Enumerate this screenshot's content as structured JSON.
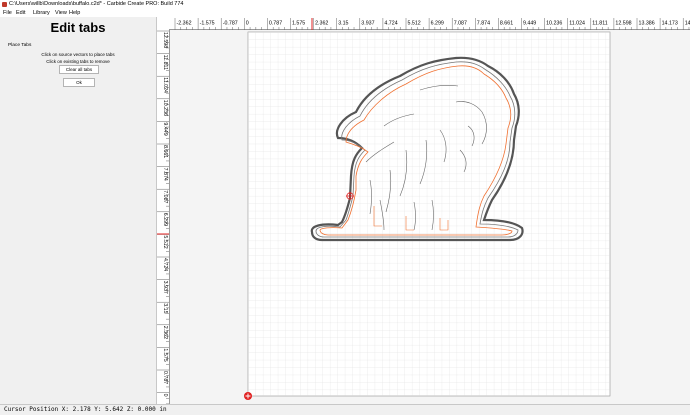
{
  "window": {
    "title": "C:\\Users\\willb\\Downloads\\buffalo.c2d* - Carbide Create PRO: Build 774"
  },
  "menu": [
    "File",
    "Edit",
    "Library",
    "View",
    "Help"
  ],
  "panel": {
    "title": "Edit tabs",
    "section_label": "Place Tabs",
    "hint_add": "Click on source vectors to place tabs",
    "hint_remove": "Click on existing tabs to remove",
    "clear_button": "Clear all tabs",
    "ok_button": "Ok"
  },
  "rulers": {
    "top_ticks": [
      "-2.362",
      "-1.575",
      "-0.787",
      "0",
      "0.787",
      "1.575",
      "2.362",
      "3.15",
      "3.937",
      "4.724",
      "5.512",
      "6.299",
      "7.087",
      "7.874",
      "8.661",
      "9.449",
      "10.236",
      "11.024",
      "11.811",
      "12.598",
      "13.386",
      "14.173",
      "14.961"
    ],
    "left_ticks": [
      "12.598",
      "11.811",
      "11.024",
      "10.236",
      "9.449",
      "8.661",
      "7.874",
      "7.087",
      "6.299",
      "5.512",
      "4.724",
      "3.937",
      "3.15",
      "2.362",
      "1.575",
      "0.787",
      "0"
    ]
  },
  "cursor": {
    "x": "2.178",
    "y": "5.642",
    "z": "0.000",
    "unit": "in"
  },
  "status_text": "Cursor Position X: 2.178 Y: 5.642 Z: 0.000 in",
  "colors": {
    "accent_red": "#e02020",
    "toolpath_orange": "#f07030",
    "vector_gray": "#555555",
    "grid_line": "#d0d0d0"
  },
  "icons": [
    "app-icon",
    "origin-marker-icon",
    "cursor-crosshair-icon"
  ]
}
